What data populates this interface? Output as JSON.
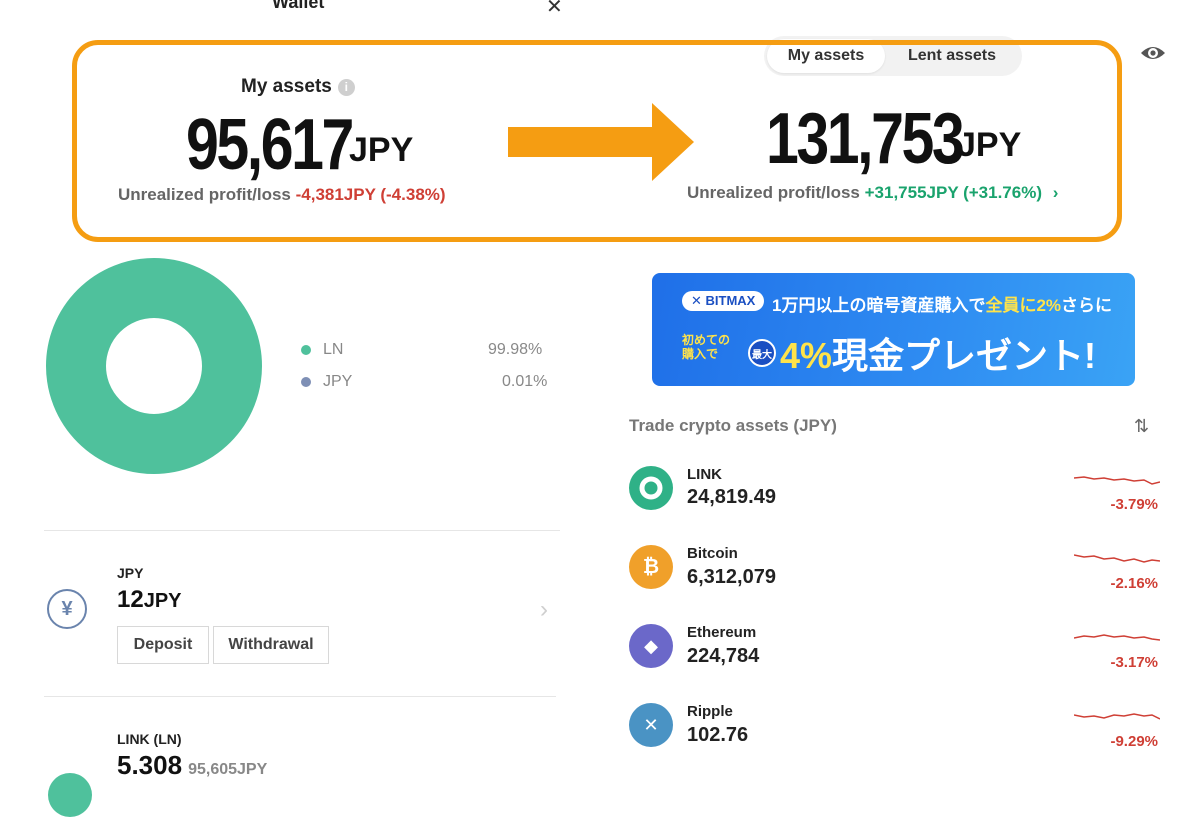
{
  "header": {
    "title_cut": "Wallet",
    "close_glyph": "✕"
  },
  "tabs": {
    "active": "My assets",
    "inactive": "Lent assets"
  },
  "summary_left": {
    "label": "My assets",
    "value": "95,617",
    "unit": "JPY",
    "upl_label": "Unrealized profit/loss",
    "upl_value": "-4,381JPY (-4.38%)"
  },
  "summary_right": {
    "value": "131,753",
    "unit": "JPY",
    "upl_label": "Unrealized profit/loss",
    "upl_value": "+31,755JPY (+31.76%)"
  },
  "allocation": {
    "items": [
      {
        "name": "LN",
        "percent": "99.98%",
        "color": "#4fc19c"
      },
      {
        "name": "JPY",
        "percent": "0.01%",
        "color": "#7e8fb5"
      }
    ]
  },
  "accounts": {
    "jpy": {
      "label": "JPY",
      "value": "12",
      "unit": "JPY",
      "deposit": "Deposit",
      "withdrawal": "Withdrawal"
    },
    "link": {
      "label": "LINK (LN)",
      "value": "5.308",
      "sub": "95,605JPY"
    }
  },
  "banner": {
    "logo": "✕ BITMAX",
    "line1_a": "1万円以上の暗号資産購入で",
    "line1_b": "全員に2%",
    "line1_c": "さらに",
    "small": "初めての購入で",
    "max": "最大",
    "big_a": "4%",
    "big_b": "現金プレゼント!"
  },
  "trade": {
    "title": "Trade crypto assets (JPY)",
    "coins": [
      {
        "name": "LINK",
        "price": "24,819.49",
        "change": "-3.79%",
        "color": "#2fb187",
        "icon": "link-icon"
      },
      {
        "name": "Bitcoin",
        "price": "6,312,079",
        "change": "-2.16%",
        "color": "#f0a02a",
        "icon": "bitcoin-icon",
        "glyph": "₿"
      },
      {
        "name": "Ethereum",
        "price": "224,784",
        "change": "-3.17%",
        "color": "#6b68c9",
        "icon": "ethereum-icon",
        "glyph": "◆"
      },
      {
        "name": "Ripple",
        "price": "102.76",
        "change": "-9.29%",
        "color": "#4a93c4",
        "icon": "ripple-icon",
        "glyph": "✕"
      }
    ]
  }
}
